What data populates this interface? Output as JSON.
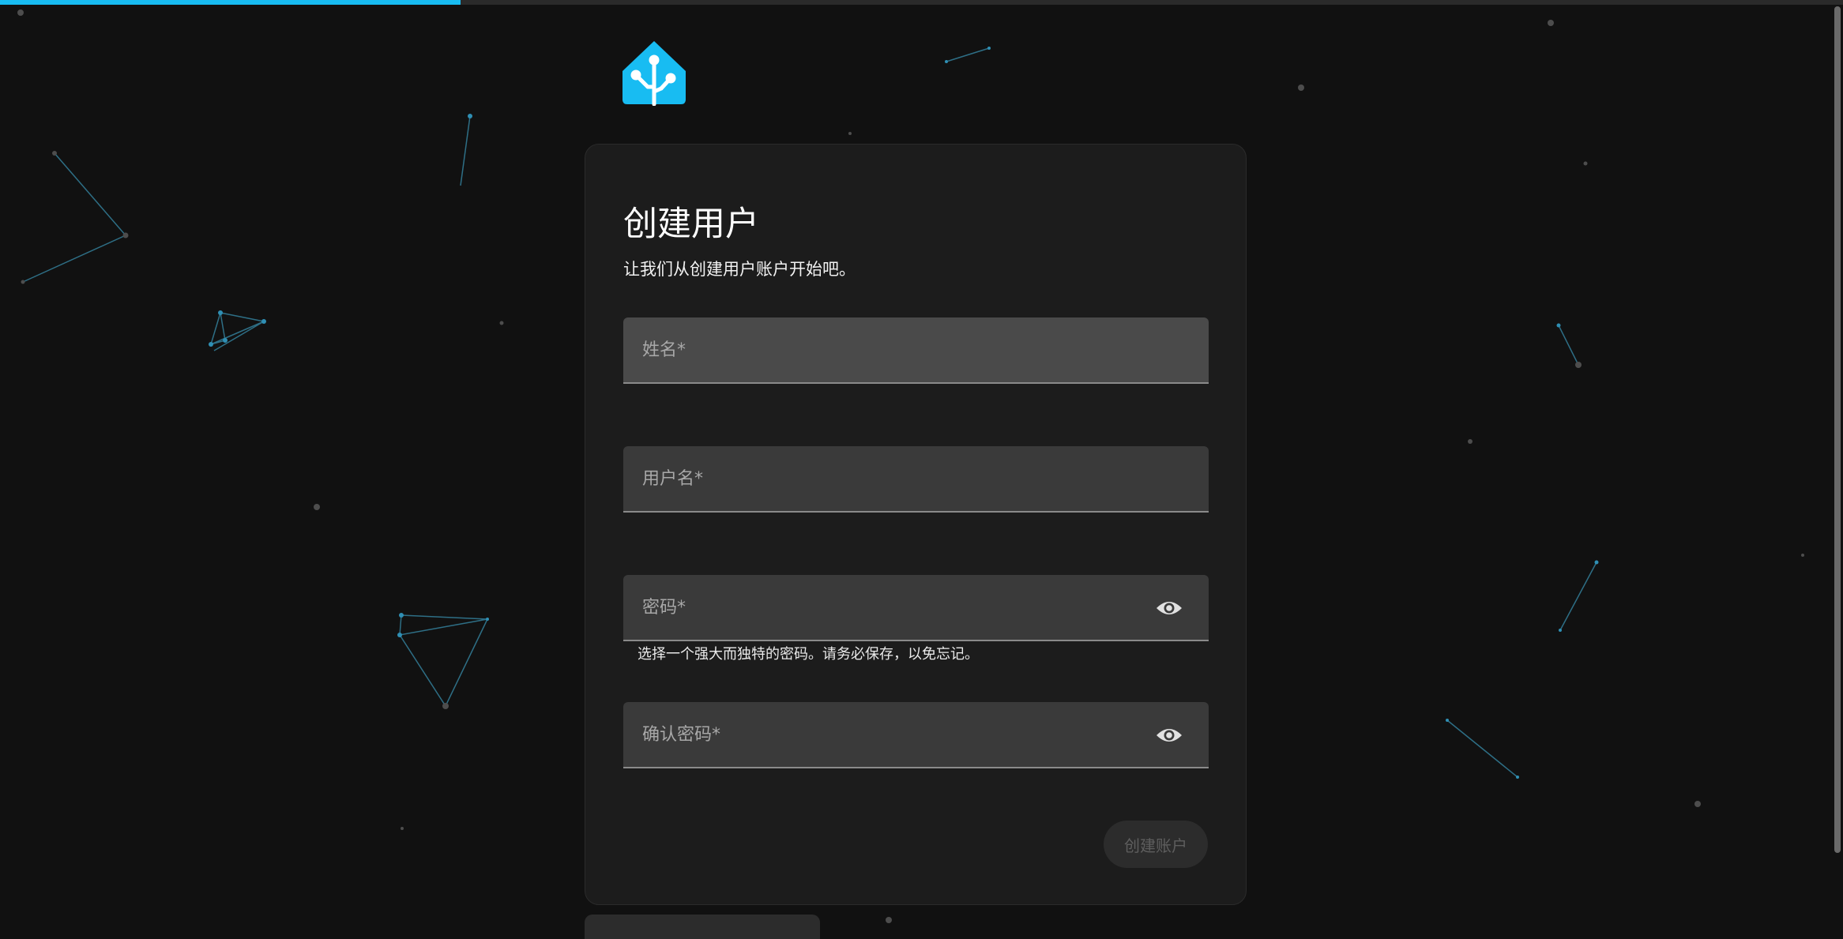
{
  "progress": {
    "value": 0.25
  },
  "logo": {
    "icon": "home-assistant-logo-icon",
    "color": "#18bcf2"
  },
  "form": {
    "title": "创建用户",
    "subtitle": "让我们从创建用户账户开始吧。",
    "name_field": {
      "placeholder": "姓名*",
      "value": ""
    },
    "username_field": {
      "placeholder": "用户名*",
      "value": ""
    },
    "password_field": {
      "placeholder": "密码*",
      "value": "",
      "toggle_icon": "eye-icon"
    },
    "password_helper": "选择一个强大而独特的密码。请务必保存，以免忘记。",
    "confirm_password_field": {
      "placeholder": "确认密码*",
      "value": "",
      "toggle_icon": "eye-icon"
    },
    "submit_label": "创建账户"
  },
  "colors": {
    "accent": "#18bcf2",
    "background": "#111111",
    "card": "#1c1c1c",
    "field": "#3a3a3a"
  }
}
